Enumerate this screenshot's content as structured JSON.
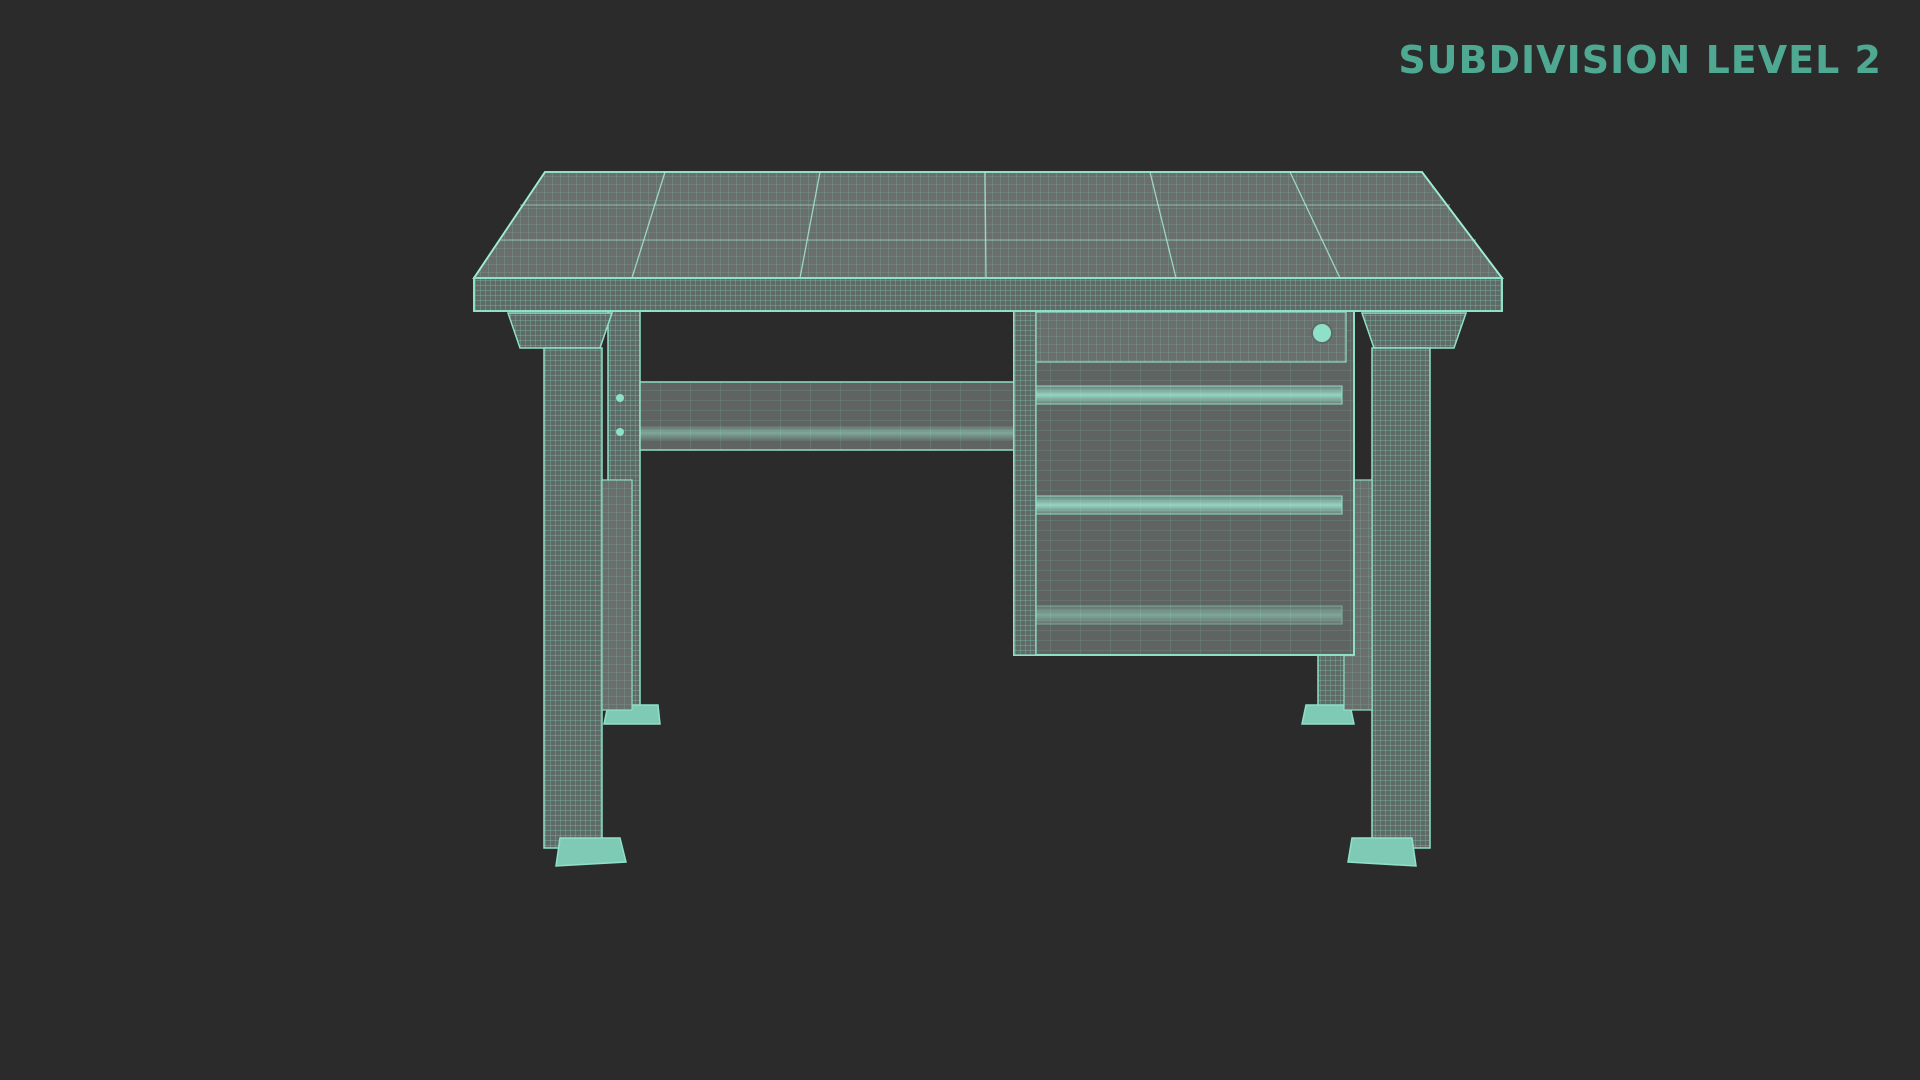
{
  "overlay": {
    "label": "SUBDIVISION LEVEL 2"
  },
  "colors": {
    "background": "#2b2b2b",
    "label": "#4ea892",
    "wire": "#8fe0c8",
    "wire_dense": "#6fc4ab",
    "surface": "#6f7371",
    "surface_dark": "#565957"
  },
  "model": {
    "object": "desk-wireframe-render",
    "features": [
      "desktop-top",
      "two-leg-frames",
      "crossbar",
      "drawer-cabinet",
      "keyhole-lock",
      "adjustable-feet"
    ]
  }
}
